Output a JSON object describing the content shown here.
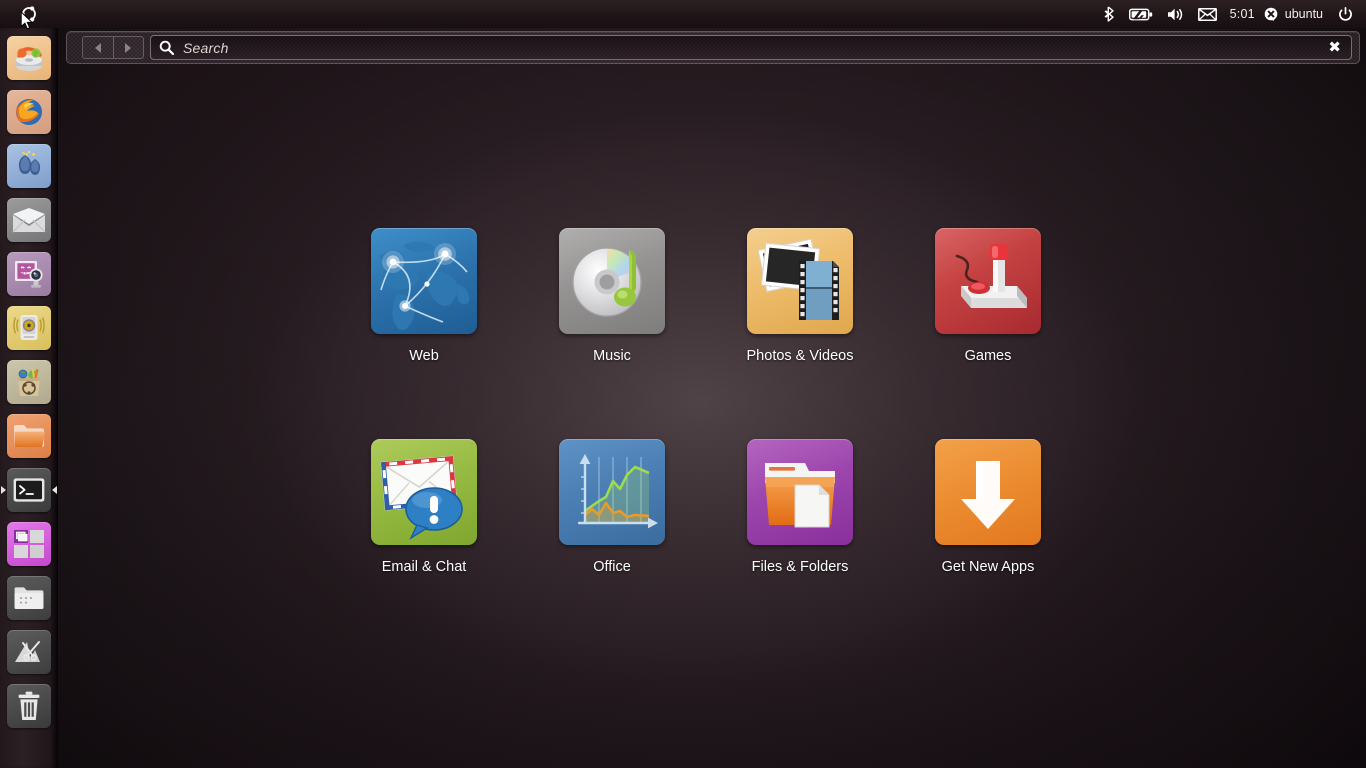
{
  "panel": {
    "home_button_name": "ubuntu-logo",
    "indicators": [
      {
        "name": "bluetooth-icon",
        "label": ""
      },
      {
        "name": "battery-icon",
        "label": ""
      },
      {
        "name": "volume-icon",
        "label": ""
      },
      {
        "name": "messaging-icon",
        "label": ""
      },
      {
        "name": "clock",
        "label": "5:01"
      },
      {
        "name": "user-menu",
        "label": "ubuntu"
      },
      {
        "name": "power-icon",
        "label": ""
      }
    ]
  },
  "launcher": {
    "items": [
      {
        "name": "launcher-item-software-center",
        "label": "Ubuntu Software Center",
        "running": false,
        "focused": false
      },
      {
        "name": "launcher-item-firefox",
        "label": "Firefox Web Browser",
        "running": false,
        "focused": false
      },
      {
        "name": "launcher-item-empathy",
        "label": "Empathy Instant Messenger",
        "running": false,
        "focused": false
      },
      {
        "name": "launcher-item-thunderbird",
        "label": "Thunderbird Mail",
        "running": false,
        "focused": false
      },
      {
        "name": "launcher-item-cheese",
        "label": "Cheese Webcam Booth",
        "running": false,
        "focused": false
      },
      {
        "name": "launcher-item-rhythmbox",
        "label": "Rhythmbox Music Player",
        "running": false,
        "focused": false
      },
      {
        "name": "launcher-item-update-manager",
        "label": "Update Manager",
        "running": false,
        "focused": false
      },
      {
        "name": "launcher-item-files",
        "label": "Home Folder",
        "running": false,
        "focused": false
      },
      {
        "name": "launcher-item-terminal",
        "label": "Terminal",
        "running": true,
        "focused": true
      },
      {
        "name": "launcher-item-workspace-switcher",
        "label": "Workspace Switcher",
        "running": false,
        "focused": false
      },
      {
        "name": "launcher-item-file-manager",
        "label": "Files",
        "running": false,
        "focused": false
      },
      {
        "name": "launcher-item-ubuntu-one",
        "label": "Ubuntu One",
        "running": false,
        "focused": false
      },
      {
        "name": "launcher-item-trash",
        "label": "Trash",
        "running": false,
        "focused": false
      }
    ]
  },
  "search": {
    "placeholder": "Search",
    "value": "",
    "back_label": "",
    "forward_label": "",
    "clear_label": "✖"
  },
  "dash": {
    "categories": [
      {
        "id": "web",
        "label": "Web",
        "icon": "globe-network-icon",
        "color": "#2c72ad"
      },
      {
        "id": "music",
        "label": "Music",
        "icon": "cd-music-note-icon",
        "color": "#949392"
      },
      {
        "id": "photo",
        "label": "Photos & Videos",
        "icon": "photos-filmstrip-icon",
        "color": "#eebc6b"
      },
      {
        "id": "games",
        "label": "Games",
        "icon": "joystick-icon",
        "color": "#c54242"
      },
      {
        "id": "email",
        "label": "Email & Chat",
        "icon": "envelope-chat-icon",
        "color": "#97bb42"
      },
      {
        "id": "office",
        "label": "Office",
        "icon": "line-chart-icon",
        "color": "#4b7fb4"
      },
      {
        "id": "files",
        "label": "Files & Folders",
        "icon": "folder-document-icon",
        "color": "#9c46ad"
      },
      {
        "id": "apps",
        "label": "Get New Apps",
        "icon": "download-arrow-icon",
        "color": "#ec8d32"
      }
    ]
  },
  "colors": {
    "panel_bg": "#1f1518",
    "launcher_bg": "#2d2126",
    "dash_bg": "#241a1f",
    "accent_orange": "#dd4814",
    "text": "#ffffff"
  }
}
